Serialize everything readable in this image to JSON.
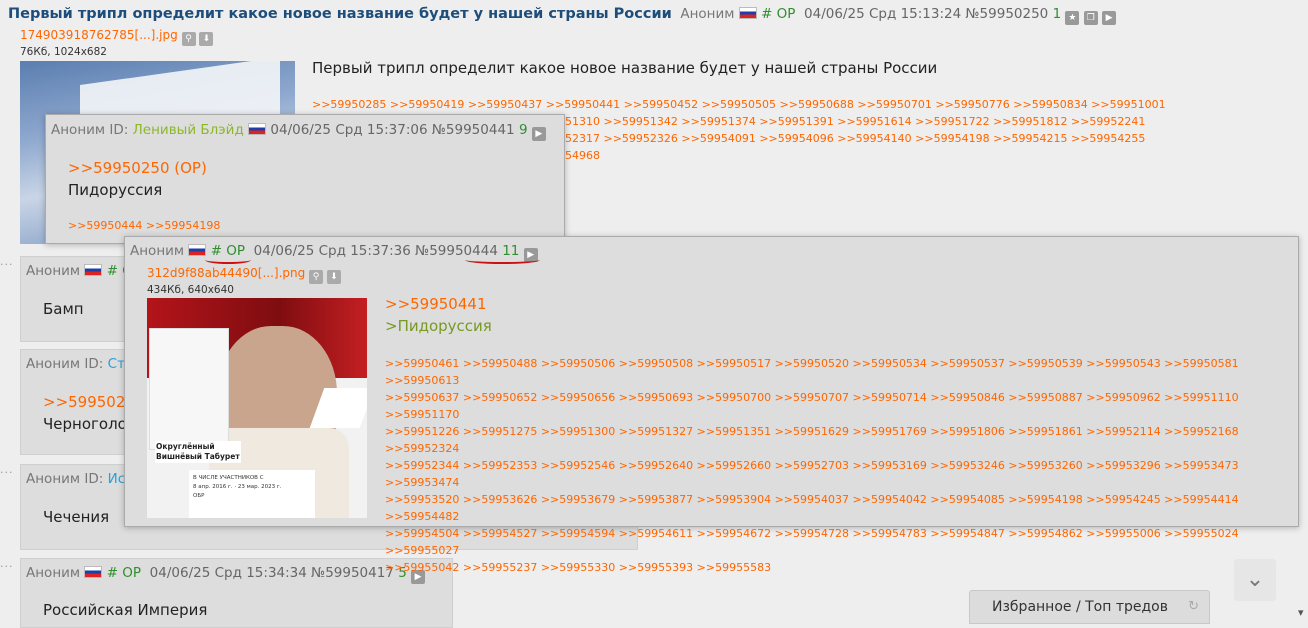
{
  "op": {
    "subject": "Первый трипл определит какое новое название будет у нашей страны России",
    "name": "Аноним",
    "op_tag": "# OP",
    "date": "04/06/25 Срд 15:13:24",
    "num": "№59950250",
    "replies_count": "1",
    "file_name": "174903918762785[...].jpg",
    "file_info": "76Кб, 1024x682",
    "body": "Первый трипл определит какое новое название будет у нашей страны России",
    "reply_links": [
      ">>59950285 >>59950419 >>59950437 >>59950441 >>59950452 >>59950505 >>59950688 >>59950701 >>59950776 >>59950834 >>59951001",
      "51310 >>59951342 >>59951374 >>59951391 >>59951614 >>59951722 >>59951812 >>59952241",
      "52317 >>59952326 >>59954091 >>59954096 >>59954140 >>59954198 >>59954215 >>59954255",
      "54968"
    ]
  },
  "popup1": {
    "name": "Аноним",
    "id_label": "ID:",
    "id_value": "Ленивый Блэйд",
    "date": "04/06/25 Срд 15:37:06",
    "num": "№59950441",
    "replies_count": "9",
    "quote_link": ">>59950250 (OP)",
    "text": "Пидоруссия",
    "reply_links": ">>59950444 >>59954198"
  },
  "popup2": {
    "name": "Аноним",
    "op_tag": "# OP",
    "date": "04/06/25 Срд 15:37:36",
    "num": "№59950444",
    "replies_count": "11",
    "file_name": "312d9f88ab44490[...].png",
    "file_info": "434Кб, 640x640",
    "quote_link": ">>59950441",
    "greentext": ">Пидоруссия",
    "reply_links": [
      ">>59950461 >>59950488 >>59950506 >>59950508 >>59950517 >>59950520 >>59950534 >>59950537 >>59950539 >>59950543 >>59950581 >>59950613",
      ">>59950637 >>59950652 >>59950656 >>59950693 >>59950700 >>59950707 >>59950714 >>59950846 >>59950887 >>59950962 >>59951110 >>59951170",
      ">>59951226 >>59951275 >>59951300 >>59951327 >>59951351 >>59951629 >>59951769 >>59951806 >>59951861 >>59952114 >>59952168 >>59952324",
      ">>59952344 >>59952353 >>59952546 >>59952640 >>59952660 >>59952703 >>59953169 >>59953246 >>59953260 >>59953296 >>59953473 >>59953474",
      ">>59953520 >>59953626 >>59953679 >>59953877 >>59953904 >>59954037 >>59954042 >>59954085 >>59954198 >>59954245 >>59954414 >>59954482",
      ">>59954504 >>59954527 >>59954594 >>59954611 >>59954672 >>59954728 >>59954783 >>59954847 >>59954862 >>59955006 >>59955024 >>59955027",
      ">>59955042 >>59955237 >>59955330 >>59955393 >>59955583"
    ],
    "image_text": {
      "caption1": "Округлённый",
      "caption2": "Вишнёвый Табурет",
      "caption3": "В ЧИСЛЕ УЧАСТНИКОВ С",
      "caption4": "8 апр. 2016 г. · 23 мар. 2023 г.",
      "caption5": "ОБР"
    }
  },
  "posts": {
    "p1": {
      "name": "Аноним",
      "op_tag": "# OP",
      "text": "Бамп"
    },
    "p2": {
      "name": "Аноним",
      "id_label": "ID:",
      "id_value": "Сте",
      "quote": ">>5995025",
      "text": "Черноголо"
    },
    "p3": {
      "name": "Аноним",
      "id_label": "ID:",
      "id_value": "Ист",
      "text": "Чечения"
    },
    "p4": {
      "name": "Аноним",
      "op_tag": "# OP",
      "date": "04/06/25 Срд 15:34:34",
      "num": "№59950417",
      "replies_count": "5",
      "text": "Российская Империя"
    }
  },
  "footer": {
    "favorites_label": "Избранное / Топ тредов"
  },
  "colors": {
    "accent_orange": "#ff6600",
    "op_green": "#2f8f2f",
    "subject_blue": "#1d4d7a",
    "greentext": "#789922"
  }
}
